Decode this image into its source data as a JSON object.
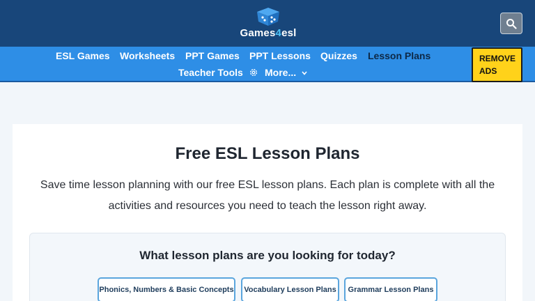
{
  "header": {
    "logo_text_prefix": "Games",
    "logo_text_accent": "4",
    "logo_text_suffix": "esl",
    "logo_icon": "graduation-cap-dice-icon",
    "search_icon": "search-icon"
  },
  "nav": {
    "items": [
      {
        "label": "ESL Games"
      },
      {
        "label": "Worksheets"
      },
      {
        "label": "PPT Games"
      },
      {
        "label": "PPT Lessons"
      },
      {
        "label": "Quizzes"
      },
      {
        "label": "Lesson Plans",
        "active": true
      },
      {
        "label": "Teacher Tools",
        "icon": "gear-icon"
      },
      {
        "label": "More...",
        "icon": "chevron-down-icon"
      }
    ],
    "remove_ads_line1": "REMOVE",
    "remove_ads_line2": "ADS"
  },
  "main": {
    "title": "Free ESL Lesson Plans",
    "description": "Save time lesson planning with our free ESL lesson plans. Each plan is complete with all the activities and resources you need to teach the lesson right away.",
    "finder": {
      "question": "What lesson plans are you looking for today?",
      "buttons": [
        {
          "label": "Phonics, Numbers & Basic Concepts"
        },
        {
          "label": "Vocabulary Lesson Plans"
        },
        {
          "label": "Grammar Lesson Plans"
        }
      ]
    }
  },
  "colors": {
    "header_bg": "#18467a",
    "nav_bg": "#2e8ee6",
    "active_nav": "#0d2846",
    "remove_ads_bg": "#ffd21a",
    "plan_button_border": "#5aa5dd"
  }
}
